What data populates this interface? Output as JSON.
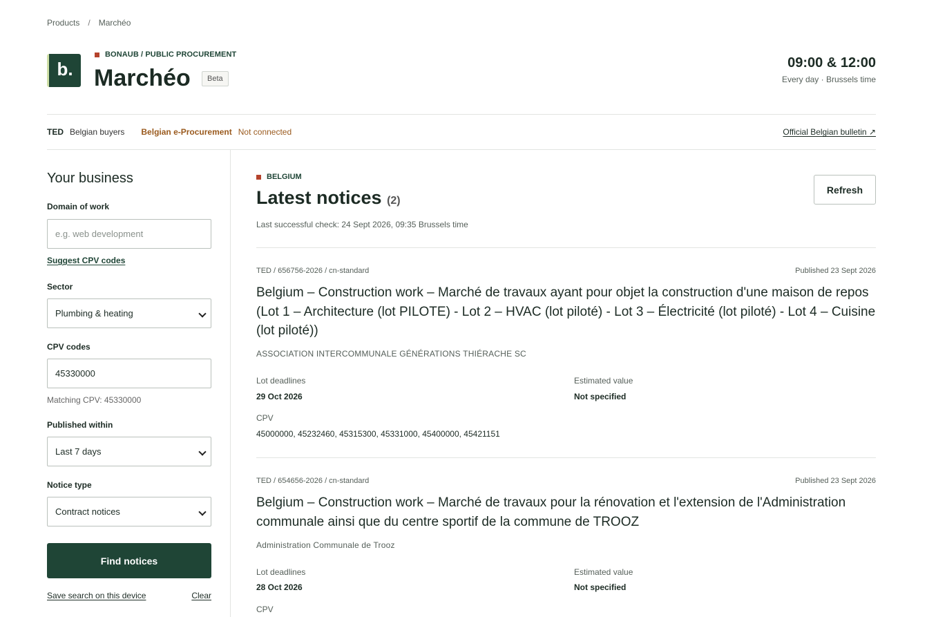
{
  "breadcrumb": {
    "items": [
      "Products",
      "Marchéo"
    ],
    "separator": "/"
  },
  "header": {
    "logo_text": "b.",
    "kicker": "BONAUB / PUBLIC PROCUREMENT",
    "title": "Marchéo",
    "badge": "Beta",
    "schedule_time": "09:00 & 12:00",
    "schedule_sub": "Every day · Brussels time"
  },
  "sources": {
    "ted_label": "TED",
    "ted_value": "Belgian buyers",
    "eproc_label": "Belgian e-Procurement",
    "eproc_status": "Not connected",
    "bulletin_link": "Official Belgian bulletin ↗"
  },
  "sidebar": {
    "heading": "Your business",
    "domain_label": "Domain of work",
    "domain_placeholder": "e.g. web development",
    "suggest_link": "Suggest CPV codes",
    "sector_label": "Sector",
    "sector_value": "Plumbing & heating",
    "cpv_label": "CPV codes",
    "cpv_value": "45330000",
    "cpv_hint": "Matching CPV: 45330000",
    "published_label": "Published within",
    "published_value": "Last 7 days",
    "type_label": "Notice type",
    "type_value": "Contract notices",
    "find_button": "Find notices",
    "save_link": "Save search on this device",
    "clear_link": "Clear"
  },
  "main": {
    "kicker": "BELGIUM",
    "title": "Latest notices",
    "count": "(2)",
    "last_check": "Last successful check: 24 Sept 2026, 09:35 Brussels time",
    "refresh_button": "Refresh",
    "labels": {
      "deadlines": "Lot deadlines",
      "value": "Estimated value",
      "cpv": "CPV"
    },
    "notices": [
      {
        "meta": "TED / 656756-2026 / cn-standard",
        "published": "Published 23 Sept 2026",
        "title": "Belgium – Construction work – Marché de travaux ayant pour objet la construction d'une maison de repos (Lot 1 – Architecture (lot PILOTE) - Lot 2 – HVAC (lot piloté) - Lot 3 – Électricité (lot piloté) - Lot 4 – Cuisine (lot piloté))",
        "buyer": "ASSOCIATION INTERCOMMUNALE GÉNÉRATIONS THIÉRACHE SC",
        "deadline": "29 Oct 2026",
        "estimated_value": "Not specified",
        "cpv": "45000000, 45232460, 45315300, 45331000, 45400000, 45421151"
      },
      {
        "meta": "TED / 654656-2026 / cn-standard",
        "published": "Published 23 Sept 2026",
        "title": "Belgium – Construction work – Marché de travaux pour la rénovation et l'extension de l'Administration communale ainsi que du centre sportif de la commune de TROOZ",
        "buyer": "Administration Communale de Trooz",
        "deadline": "28 Oct 2026",
        "estimated_value": "Not specified"
      }
    ]
  }
}
